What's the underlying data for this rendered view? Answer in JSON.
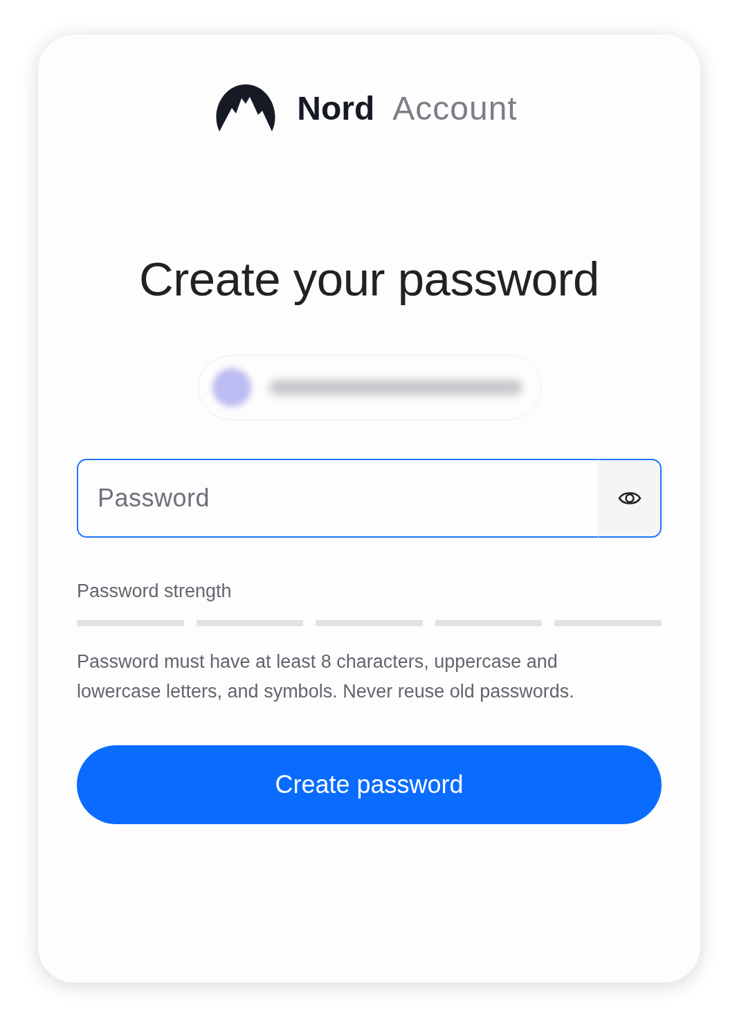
{
  "brand": {
    "name": "Nord",
    "product": "Account"
  },
  "title": "Create your password",
  "account_chip": {
    "blurred": true
  },
  "password_field": {
    "placeholder": "Password",
    "focused": true
  },
  "strength": {
    "label": "Password strength"
  },
  "hint": "Password must have at least 8 characters, uppercase and lowercase letters, and symbols. Never reuse old passwords.",
  "submit_button": {
    "label": "Create password"
  }
}
